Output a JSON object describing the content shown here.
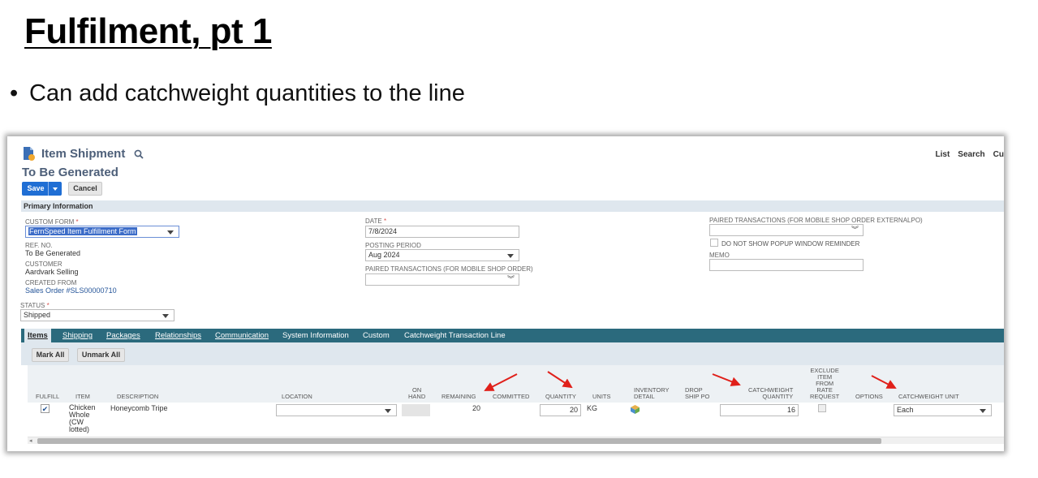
{
  "slide": {
    "title": "Fulfilment, pt 1",
    "bullet": "Can add catchweight quantities to the line"
  },
  "header": {
    "title": "Item Shipment",
    "subtitle": "To Be Generated",
    "links": [
      "List",
      "Search",
      "Cu"
    ]
  },
  "toolbar": {
    "save": "Save",
    "cancel": "Cancel"
  },
  "primary": {
    "section": "Primary Information",
    "custom_form_label": "CUSTOM FORM",
    "custom_form_value": "FernSpeed Item Fulfillment Form",
    "ref_no_label": "REF. NO.",
    "ref_no_value": "To Be Generated",
    "customer_label": "CUSTOMER",
    "customer_value": "Aardvark Selling",
    "created_from_label": "CREATED FROM",
    "created_from_value": "Sales Order #SLS00000710",
    "status_label": "STATUS",
    "status_value": "Shipped",
    "date_label": "DATE",
    "date_value": "7/8/2024",
    "posting_period_label": "POSTING PERIOD",
    "posting_period_value": "Aug 2024",
    "paired_mobile_label": "PAIRED TRANSACTIONS (FOR MOBILE SHOP ORDER)",
    "paired_external_label": "PAIRED TRANSACTIONS (FOR MOBILE SHOP ORDER EXTERNALPO)",
    "no_popup_label": "DO NOT SHOW POPUP WINDOW REMINDER",
    "memo_label": "MEMO",
    "required_mark": "*"
  },
  "tabs": [
    "Items",
    "Shipping",
    "Packages",
    "Relationships",
    "Communication",
    "System Information",
    "Custom",
    "Catchweight Transaction Line"
  ],
  "subtab_buttons": {
    "mark_all": "Mark All",
    "unmark_all": "Unmark All"
  },
  "columns": {
    "fulfill": "FULFILL",
    "item": "ITEM",
    "description": "DESCRIPTION",
    "location": "LOCATION",
    "on_hand_1": "ON",
    "on_hand_2": "HAND",
    "remaining": "REMAINING",
    "committed": "COMMITTED",
    "quantity": "QUANTITY",
    "units": "UNITS",
    "inventory_detail_1": "INVENTORY",
    "inventory_detail_2": "DETAIL",
    "drop_ship_1": "DROP",
    "drop_ship_2": "SHIP PO",
    "cw_qty_1": "CATCHWEIGHT",
    "cw_qty_2": "QUANTITY",
    "exclude_1": "EXCLUDE",
    "exclude_2": "ITEM",
    "exclude_3": "FROM",
    "exclude_4": "RATE",
    "exclude_5": "REQUEST",
    "options": "OPTIONS",
    "cw_unit": "CATCHWEIGHT UNIT"
  },
  "row": {
    "item_lines": [
      "Chicken",
      "Whole",
      "(CW",
      "lotted)"
    ],
    "description": "Honeycomb Tripe",
    "remaining": "20",
    "quantity": "20",
    "units": "KG",
    "catchweight_quantity": "16",
    "catchweight_unit": "Each",
    "fulfill_mark": "✔"
  },
  "colors": {
    "accent": "#1f6ed4",
    "tabbar": "#2b6a7d",
    "arrow": "#e0201a",
    "title_text": "#4d5f79"
  }
}
